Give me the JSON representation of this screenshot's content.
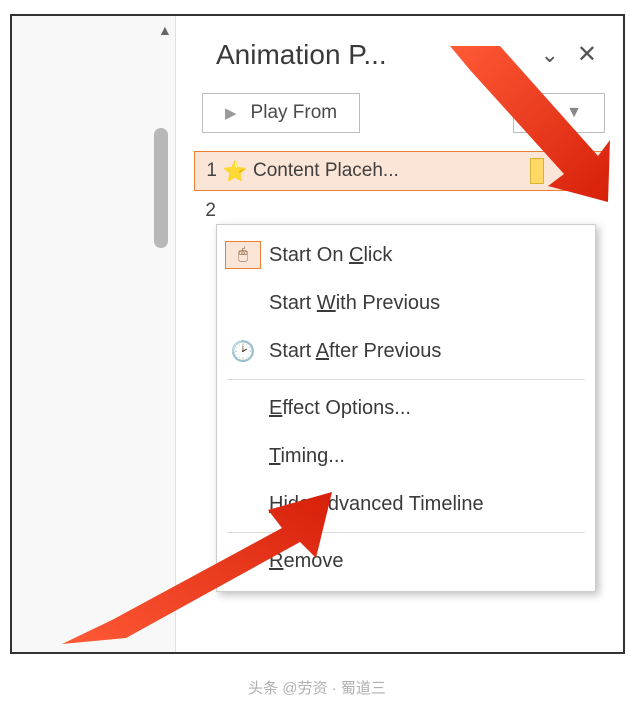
{
  "pane": {
    "title": "Animation P...",
    "play_button": "Play From"
  },
  "animations": [
    {
      "num": "1",
      "icon": "⭐",
      "label": "Content Placeh...",
      "selected": true
    },
    {
      "num": "2",
      "icon": "",
      "label": "",
      "selected": false
    }
  ],
  "menu": {
    "start_on_click": {
      "pre": "Start On ",
      "u": "C",
      "post": "lick"
    },
    "start_with_previous": {
      "pre": "Start ",
      "u": "W",
      "post": "ith Previous"
    },
    "start_after_previous": {
      "pre": "Start ",
      "u": "A",
      "post": "fter Previous"
    },
    "effect_options": {
      "pre": "",
      "u": "E",
      "post": "ffect Options..."
    },
    "timing": {
      "pre": "",
      "u": "T",
      "post": "iming..."
    },
    "hide_timeline": {
      "pre": "",
      "u": "H",
      "post": "ide Advanced Timeline"
    },
    "remove": {
      "pre": "",
      "u": "R",
      "post": "emove"
    }
  },
  "footer": "头条 @劳资 · 蜀道三"
}
